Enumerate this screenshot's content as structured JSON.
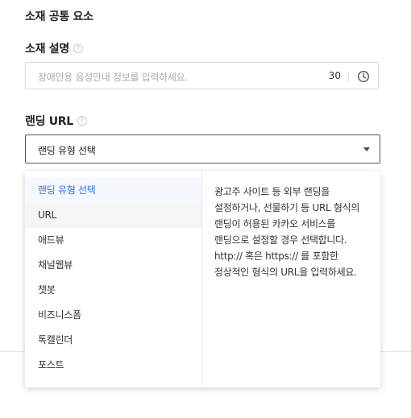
{
  "section": {
    "title": "소재 공통 요소"
  },
  "description": {
    "label": "소재 설명",
    "help": "?",
    "placeholder": "장애인용 음성안내 정보를 입력하세요.",
    "char_count": "30"
  },
  "landing_url": {
    "label": "랜딩 URL",
    "help": "?",
    "selected_value": "랜딩 유형 선택"
  },
  "dropdown": {
    "options": [
      {
        "label": "랜딩 유형 선택"
      },
      {
        "label": "URL"
      },
      {
        "label": "애드뷰"
      },
      {
        "label": "채널웹뷰"
      },
      {
        "label": "챗봇"
      },
      {
        "label": "비즈니스폼"
      },
      {
        "label": "톡캘린더"
      },
      {
        "label": "포스트"
      }
    ],
    "help_text": "광고주 사이트 등 외부 랜딩을 설정하거나, 선물하기 등 URL 형식의 랜딩이 허용된 카카오 서비스를 랜딩으로 설정할 경우 선택합니다. http:// 혹은 https:// 를 포함한 정상적인 형식의 URL을 입력하세요."
  },
  "colors": {
    "accent": "#326edc",
    "text": "#222222",
    "placeholder": "#aaaaaa",
    "border": "#d9d9d9"
  }
}
